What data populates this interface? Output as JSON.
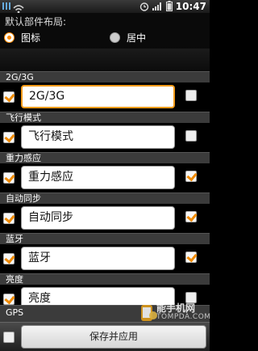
{
  "status_bar": {
    "time": "10:47",
    "icons": [
      "usb-debug-icon",
      "wifi-icon",
      "alarm-icon",
      "signal-icon",
      "battery-icon"
    ]
  },
  "header": {
    "title": "默认部件布局:",
    "options": [
      {
        "label": "图标",
        "selected": true
      },
      {
        "label": "居中",
        "selected": false
      }
    ]
  },
  "sections": [
    {
      "label": "2G/3G",
      "field_value": "2G/3G",
      "left_checked": true,
      "right_checked": false,
      "focused": true
    },
    {
      "label": "飞行模式",
      "field_value": "飞行模式",
      "left_checked": true,
      "right_checked": false,
      "focused": false
    },
    {
      "label": "重力感应",
      "field_value": "重力感应",
      "left_checked": true,
      "right_checked": true,
      "focused": false
    },
    {
      "label": "自动同步",
      "field_value": "自动同步",
      "left_checked": true,
      "right_checked": true,
      "focused": false
    },
    {
      "label": "蓝牙",
      "field_value": "蓝牙",
      "left_checked": true,
      "right_checked": true,
      "focused": false
    },
    {
      "label": "亮度",
      "field_value": "亮度",
      "left_checked": true,
      "right_checked": false,
      "focused": false
    },
    {
      "label": "GPS"
    }
  ],
  "bottom": {
    "save_label": "保存并应用",
    "checkbox_checked": false
  },
  "watermark": {
    "line1": "能手机网",
    "line2": "TOMPDA.COM"
  },
  "colors": {
    "accent": "#f39b1a",
    "section_bar": "#3b3b3b",
    "background": "#000000"
  }
}
